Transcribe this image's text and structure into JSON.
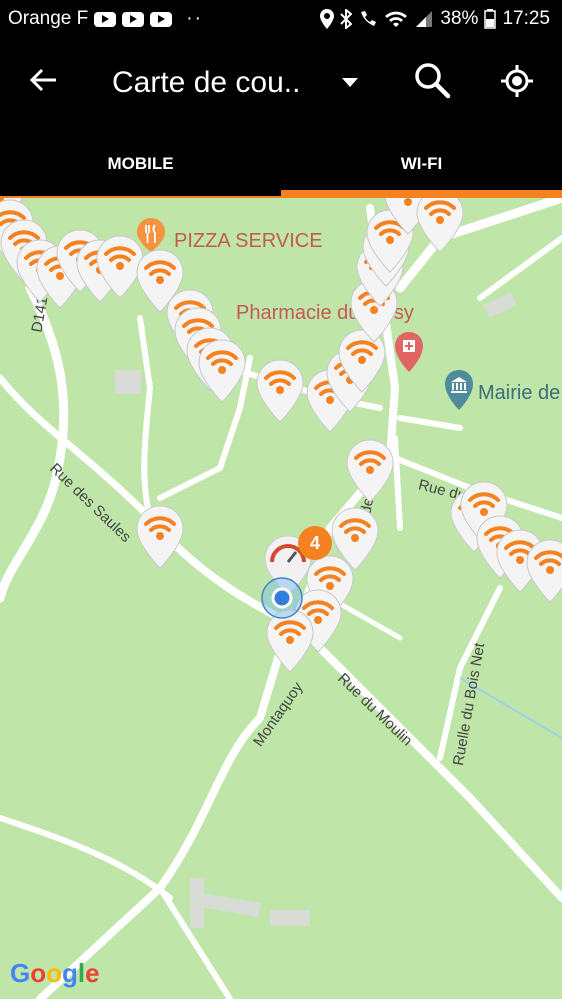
{
  "status_bar": {
    "carrier": "Orange F",
    "dots": "··",
    "battery": "38%",
    "time": "17:25"
  },
  "app_bar": {
    "title": "Carte de cou..",
    "icons": [
      "back-arrow-icon",
      "dropdown-caret-icon",
      "search-icon",
      "my-location-icon"
    ]
  },
  "tabs": [
    {
      "label": "MOBILE",
      "selected": false
    },
    {
      "label": "WI-FI",
      "selected": true
    }
  ],
  "accent_color": "#f58220",
  "map": {
    "pois": {
      "pizza": "PIZZA SERVICE",
      "pharmacy": "Pharmacie du Boisy",
      "mairie": "Mairie de"
    },
    "streets": {
      "d141": "D141",
      "saules": "Rue des Saules",
      "eglise": "Rue de l'Eglise",
      "du": "Rue du",
      "moulin": "Rue du Moulin",
      "montaquoy": "Montaquoy",
      "boisnet": "Ruelle du Bois Net"
    },
    "cluster_count": "4",
    "attribution": "Google"
  }
}
